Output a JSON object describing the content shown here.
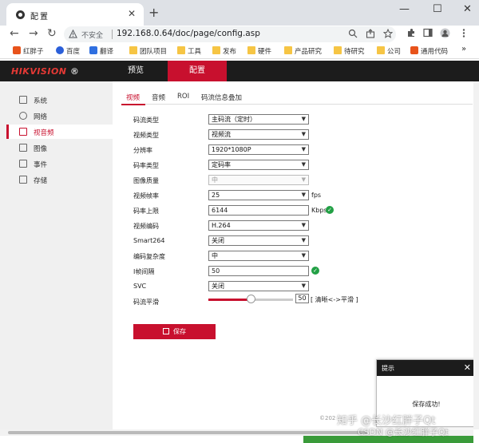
{
  "browser": {
    "tab_title": "配置",
    "tab_close": "✕",
    "new_tab": "+",
    "win_min": "—",
    "win_max": "☐",
    "win_close": "✕",
    "back": "←",
    "forward": "→",
    "reload": "↻",
    "insecure_label": "不安全",
    "url": "192.168.0.64/doc/page/config.asp"
  },
  "bookmarks": [
    {
      "label": "红胖子",
      "color": "#e8531b"
    },
    {
      "label": "百度",
      "color": "#2b5fd9"
    },
    {
      "label": "翻译",
      "color": "#2f6fe0"
    },
    {
      "label": "团队项目",
      "color": "#f6c544"
    },
    {
      "label": "工具",
      "color": "#f6c544"
    },
    {
      "label": "发布",
      "color": "#f6c544"
    },
    {
      "label": "硬件",
      "color": "#f6c544"
    },
    {
      "label": "产品研究",
      "color": "#f6c544"
    },
    {
      "label": "待研究",
      "color": "#f6c544"
    },
    {
      "label": "公司",
      "color": "#f6c544"
    },
    {
      "label": "通用代码",
      "color": "#e8531b"
    }
  ],
  "header": {
    "logo_main": "HIKVISION",
    "logo_mark": "®",
    "tabs": [
      {
        "label": "预览",
        "active": false
      },
      {
        "label": "配置",
        "active": true
      }
    ]
  },
  "sidebar": {
    "items": [
      {
        "label": "系统",
        "active": false
      },
      {
        "label": "网络",
        "active": false
      },
      {
        "label": "视音频",
        "active": true
      },
      {
        "label": "图像",
        "active": false
      },
      {
        "label": "事件",
        "active": false
      },
      {
        "label": "存储",
        "active": false
      }
    ]
  },
  "subtabs": [
    "视频",
    "音频",
    "ROI",
    "码流信息叠加"
  ],
  "form": {
    "stream_type": {
      "label": "码流类型",
      "value": "主码流（定时）"
    },
    "video_type": {
      "label": "视频类型",
      "value": "视频流"
    },
    "resolution": {
      "label": "分辨率",
      "value": "1920*1080P"
    },
    "bitrate_type": {
      "label": "码率类型",
      "value": "定码率"
    },
    "image_quality": {
      "label": "图像质量",
      "value": "中"
    },
    "frame_rate": {
      "label": "视频帧率",
      "value": "25",
      "suffix": "fps"
    },
    "bitrate_max": {
      "label": "码率上限",
      "value": "6144",
      "suffix": "Kbps"
    },
    "video_codec": {
      "label": "视频编码",
      "value": "H.264"
    },
    "smart264": {
      "label": "Smart264",
      "value": "关闭"
    },
    "complexity": {
      "label": "编码复杂度",
      "value": "中"
    },
    "i_interval": {
      "label": "I帧间隔",
      "value": "50"
    },
    "svc": {
      "label": "SVC",
      "value": "关闭"
    },
    "smoothing": {
      "label": "码流平滑",
      "value": "50",
      "level": 0.5,
      "hint": "[ 清晰<->平滑 ]"
    }
  },
  "save_label": "保存",
  "copyright": "©202",
  "popup": {
    "title": "提示",
    "close": "✕",
    "message": "保存成功!"
  },
  "watermark": {
    "zh": "知乎 @长沙红胖子Qt",
    "csdn": "CSDN @长沙红胖子Qt"
  },
  "colors": {
    "accent": "#c8102e",
    "header_bg": "#1c1c1c",
    "ok_green": "#22a045"
  }
}
